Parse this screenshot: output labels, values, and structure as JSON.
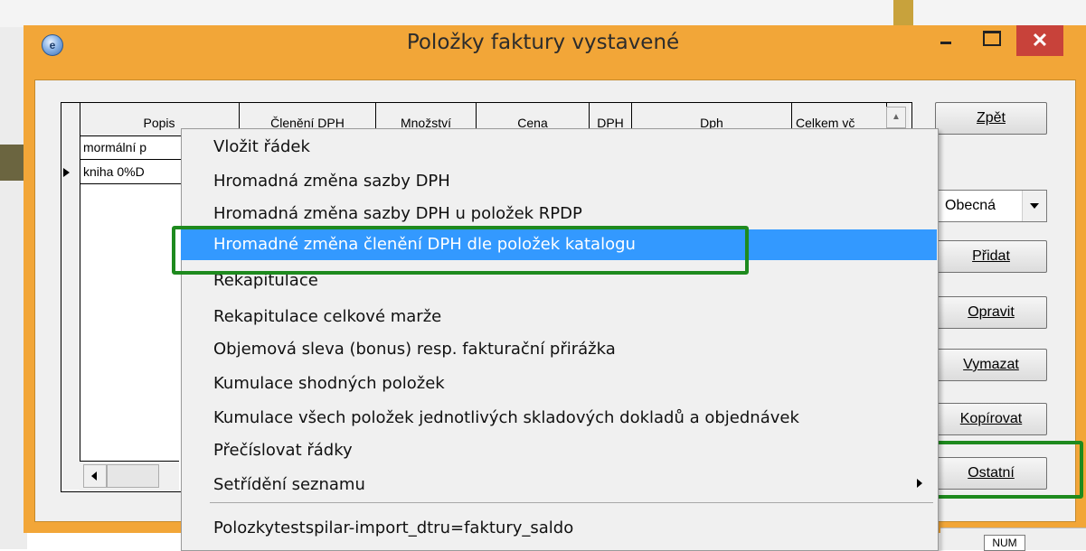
{
  "window": {
    "title": "Položky faktury vystavené",
    "close_glyph": "✕",
    "icon": "app-globe-icon"
  },
  "grid": {
    "columns": [
      "Popis",
      "Členění DPH",
      "Množství",
      "Cena",
      "DPH",
      "Dph",
      "Celkem vč"
    ],
    "rows": [
      {
        "popis": "mormální p"
      },
      {
        "popis": "kniha 0%D"
      }
    ]
  },
  "buttons": {
    "zpet": "Zpět",
    "pridat": "Přidat",
    "opravit": "Opravit",
    "vymazat": "Vymazat",
    "kopirovat": "Kopírovat",
    "ostatni": "Ostatní"
  },
  "select": {
    "value": "Obecná"
  },
  "context_menu": {
    "items": [
      "Vložit řádek",
      "Hromadná změna sazby DPH",
      "Hromadná změna sazby DPH u položek RPDP",
      "Hromadné změna členění DPH dle položek katalogu",
      "Rekapitulace",
      "Rekapitulace celkové marže",
      "Objemová sleva (bonus) resp. fakturační přirážka",
      "Kumulace shodných položek",
      "Kumulace všech položek jednotlivých skladových dokladů a objednávek",
      "Přečíslovat řádky",
      "Setřídění seznamu",
      "Polozkytestspilar-import_dtru=faktury_saldo"
    ],
    "highlighted_index": 3
  },
  "status": {
    "num": "NUM"
  },
  "colors": {
    "window_frame": "#f2a638",
    "highlight": "#3399ff",
    "annotation_green": "#1e8a1e",
    "close_red": "#c8423a"
  }
}
